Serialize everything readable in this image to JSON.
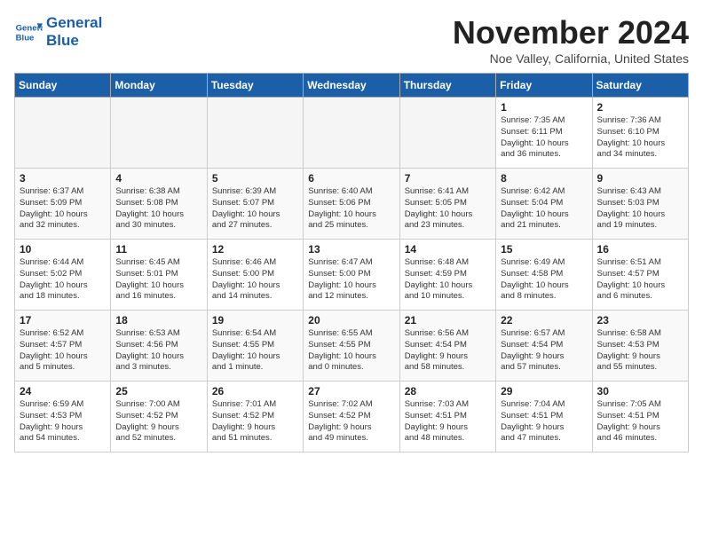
{
  "header": {
    "logo_line1": "General",
    "logo_line2": "Blue",
    "month_title": "November 2024",
    "location": "Noe Valley, California, United States"
  },
  "weekdays": [
    "Sunday",
    "Monday",
    "Tuesday",
    "Wednesday",
    "Thursday",
    "Friday",
    "Saturday"
  ],
  "weeks": [
    [
      {
        "day": "",
        "info": ""
      },
      {
        "day": "",
        "info": ""
      },
      {
        "day": "",
        "info": ""
      },
      {
        "day": "",
        "info": ""
      },
      {
        "day": "",
        "info": ""
      },
      {
        "day": "1",
        "info": "Sunrise: 7:35 AM\nSunset: 6:11 PM\nDaylight: 10 hours\nand 36 minutes."
      },
      {
        "day": "2",
        "info": "Sunrise: 7:36 AM\nSunset: 6:10 PM\nDaylight: 10 hours\nand 34 minutes."
      }
    ],
    [
      {
        "day": "3",
        "info": "Sunrise: 6:37 AM\nSunset: 5:09 PM\nDaylight: 10 hours\nand 32 minutes."
      },
      {
        "day": "4",
        "info": "Sunrise: 6:38 AM\nSunset: 5:08 PM\nDaylight: 10 hours\nand 30 minutes."
      },
      {
        "day": "5",
        "info": "Sunrise: 6:39 AM\nSunset: 5:07 PM\nDaylight: 10 hours\nand 27 minutes."
      },
      {
        "day": "6",
        "info": "Sunrise: 6:40 AM\nSunset: 5:06 PM\nDaylight: 10 hours\nand 25 minutes."
      },
      {
        "day": "7",
        "info": "Sunrise: 6:41 AM\nSunset: 5:05 PM\nDaylight: 10 hours\nand 23 minutes."
      },
      {
        "day": "8",
        "info": "Sunrise: 6:42 AM\nSunset: 5:04 PM\nDaylight: 10 hours\nand 21 minutes."
      },
      {
        "day": "9",
        "info": "Sunrise: 6:43 AM\nSunset: 5:03 PM\nDaylight: 10 hours\nand 19 minutes."
      }
    ],
    [
      {
        "day": "10",
        "info": "Sunrise: 6:44 AM\nSunset: 5:02 PM\nDaylight: 10 hours\nand 18 minutes."
      },
      {
        "day": "11",
        "info": "Sunrise: 6:45 AM\nSunset: 5:01 PM\nDaylight: 10 hours\nand 16 minutes."
      },
      {
        "day": "12",
        "info": "Sunrise: 6:46 AM\nSunset: 5:00 PM\nDaylight: 10 hours\nand 14 minutes."
      },
      {
        "day": "13",
        "info": "Sunrise: 6:47 AM\nSunset: 5:00 PM\nDaylight: 10 hours\nand 12 minutes."
      },
      {
        "day": "14",
        "info": "Sunrise: 6:48 AM\nSunset: 4:59 PM\nDaylight: 10 hours\nand 10 minutes."
      },
      {
        "day": "15",
        "info": "Sunrise: 6:49 AM\nSunset: 4:58 PM\nDaylight: 10 hours\nand 8 minutes."
      },
      {
        "day": "16",
        "info": "Sunrise: 6:51 AM\nSunset: 4:57 PM\nDaylight: 10 hours\nand 6 minutes."
      }
    ],
    [
      {
        "day": "17",
        "info": "Sunrise: 6:52 AM\nSunset: 4:57 PM\nDaylight: 10 hours\nand 5 minutes."
      },
      {
        "day": "18",
        "info": "Sunrise: 6:53 AM\nSunset: 4:56 PM\nDaylight: 10 hours\nand 3 minutes."
      },
      {
        "day": "19",
        "info": "Sunrise: 6:54 AM\nSunset: 4:55 PM\nDaylight: 10 hours\nand 1 minute."
      },
      {
        "day": "20",
        "info": "Sunrise: 6:55 AM\nSunset: 4:55 PM\nDaylight: 10 hours\nand 0 minutes."
      },
      {
        "day": "21",
        "info": "Sunrise: 6:56 AM\nSunset: 4:54 PM\nDaylight: 9 hours\nand 58 minutes."
      },
      {
        "day": "22",
        "info": "Sunrise: 6:57 AM\nSunset: 4:54 PM\nDaylight: 9 hours\nand 57 minutes."
      },
      {
        "day": "23",
        "info": "Sunrise: 6:58 AM\nSunset: 4:53 PM\nDaylight: 9 hours\nand 55 minutes."
      }
    ],
    [
      {
        "day": "24",
        "info": "Sunrise: 6:59 AM\nSunset: 4:53 PM\nDaylight: 9 hours\nand 54 minutes."
      },
      {
        "day": "25",
        "info": "Sunrise: 7:00 AM\nSunset: 4:52 PM\nDaylight: 9 hours\nand 52 minutes."
      },
      {
        "day": "26",
        "info": "Sunrise: 7:01 AM\nSunset: 4:52 PM\nDaylight: 9 hours\nand 51 minutes."
      },
      {
        "day": "27",
        "info": "Sunrise: 7:02 AM\nSunset: 4:52 PM\nDaylight: 9 hours\nand 49 minutes."
      },
      {
        "day": "28",
        "info": "Sunrise: 7:03 AM\nSunset: 4:51 PM\nDaylight: 9 hours\nand 48 minutes."
      },
      {
        "day": "29",
        "info": "Sunrise: 7:04 AM\nSunset: 4:51 PM\nDaylight: 9 hours\nand 47 minutes."
      },
      {
        "day": "30",
        "info": "Sunrise: 7:05 AM\nSunset: 4:51 PM\nDaylight: 9 hours\nand 46 minutes."
      }
    ]
  ]
}
